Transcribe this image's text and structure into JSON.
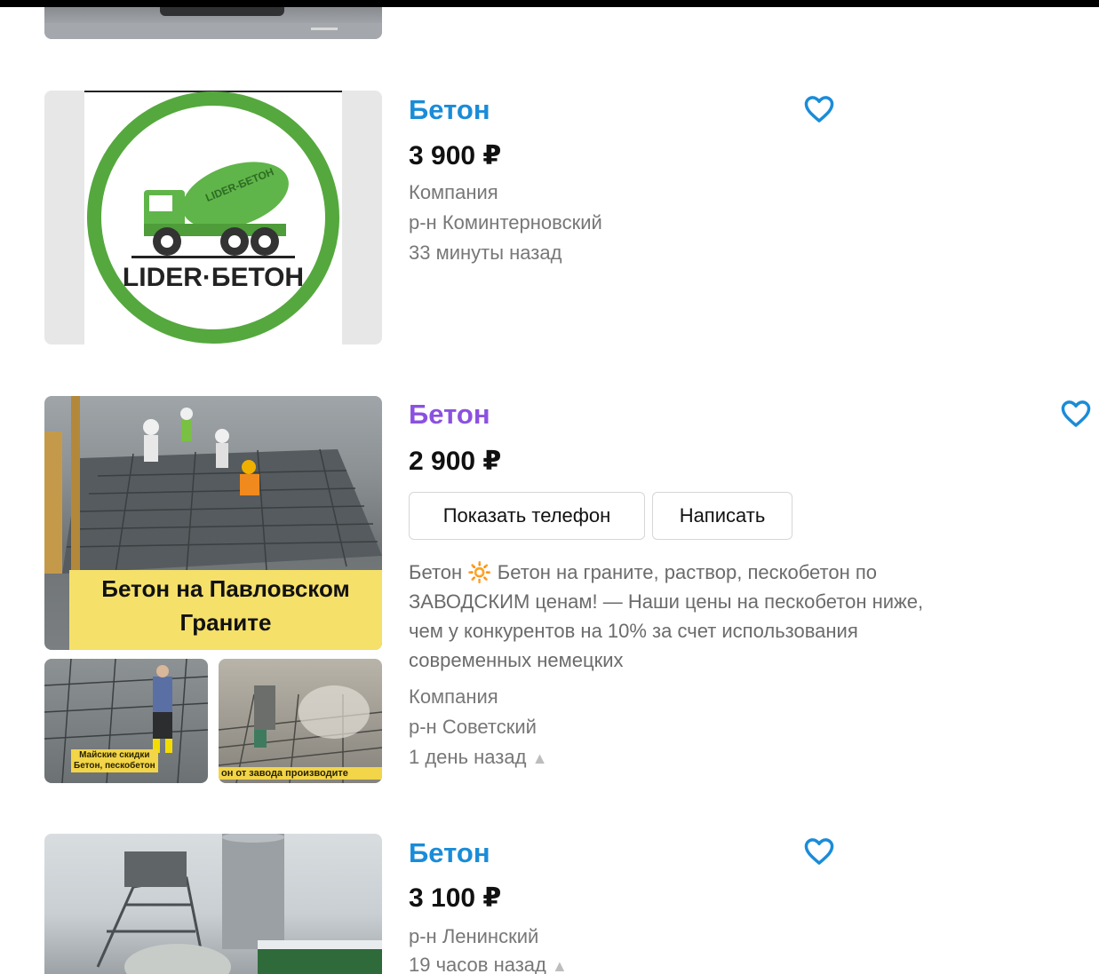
{
  "listings": [
    {
      "title": "Бетон",
      "price": "3 900 ₽",
      "seller": "Компания",
      "district": "р-н Коминтерновский",
      "time": "33 минуты назад",
      "image_logo_text": "LIDER·БЕТОН",
      "image_truck_text": "LIDER-БЕТОН"
    },
    {
      "title": "Бетон",
      "price": "2 900 ₽",
      "buttons": {
        "phone": "Показать телефон",
        "message": "Написать"
      },
      "description": "Бетон 🔆 Бетон на граните, раствор, пескобетон по ЗАВОДСКИМ ценам! — Наши цены на пескобетон ниже, чем у конкурентов на 10% за счет использования современных немецких",
      "seller": "Компания",
      "district": "р-н Советский",
      "time": "1 день назад",
      "image_caption_line1": "Бетон на Павловском",
      "image_caption_line2": "Граните",
      "thumb1_caption_line1": "Майские скидки",
      "thumb1_caption_line2": "Бетон, пескобетон",
      "thumb2_caption": "он от завода производите"
    },
    {
      "title": "Бетон",
      "price": "3 100 ₽",
      "district": "р-н Ленинский",
      "time": "19 часов назад"
    }
  ],
  "icons": {
    "favorite": "heart-outline-icon",
    "raised": "arrow-up-icon"
  },
  "colors": {
    "link": "#1a8cd8",
    "visited_link": "#8b51e0",
    "heart": "#1a8cd8"
  }
}
